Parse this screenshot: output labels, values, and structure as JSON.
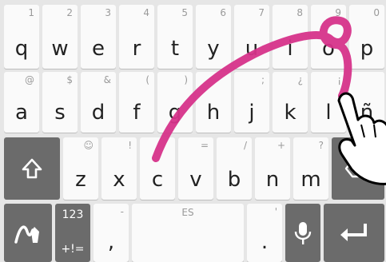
{
  "keyboard": {
    "row1": [
      {
        "letter": "q",
        "hint": "1"
      },
      {
        "letter": "w",
        "hint": "2"
      },
      {
        "letter": "e",
        "hint": "3"
      },
      {
        "letter": "r",
        "hint": "4"
      },
      {
        "letter": "t",
        "hint": "5"
      },
      {
        "letter": "y",
        "hint": "6"
      },
      {
        "letter": "u",
        "hint": "7"
      },
      {
        "letter": "i",
        "hint": "8"
      },
      {
        "letter": "o",
        "hint": "9"
      },
      {
        "letter": "p",
        "hint": "0"
      }
    ],
    "row2": [
      {
        "letter": "a",
        "hint": "@"
      },
      {
        "letter": "s",
        "hint": "$"
      },
      {
        "letter": "d",
        "hint": "&"
      },
      {
        "letter": "f",
        "hint": "("
      },
      {
        "letter": "g",
        "hint": ")"
      },
      {
        "letter": "h",
        "hint": ""
      },
      {
        "letter": "j",
        "hint": ";"
      },
      {
        "letter": "k",
        "hint": "¿"
      },
      {
        "letter": "l",
        "hint": "¡"
      },
      {
        "letter": "ñ",
        "hint": ""
      }
    ],
    "row3": [
      {
        "letter": "z",
        "hint": "☺"
      },
      {
        "letter": "x",
        "hint": "!"
      },
      {
        "letter": "c",
        "hint": ""
      },
      {
        "letter": "v",
        "hint": "="
      },
      {
        "letter": "b",
        "hint": "/"
      },
      {
        "letter": "n",
        "hint": "+"
      },
      {
        "letter": "m",
        "hint": "?"
      }
    ],
    "row4": {
      "numbers_label": "123",
      "symbols_label": "+!=",
      "comma": ",",
      "comma_hint": "-",
      "space_language": "ES",
      "period": ".",
      "period_hint": "'"
    }
  },
  "icons": {
    "shift": "shift-icon",
    "swipe": "swipe-mode-icon",
    "mic": "microphone-icon",
    "enter": "enter-icon",
    "backspace": "backspace-icon",
    "hand": "hand-pointer-icon"
  },
  "colors": {
    "trail": "#d6338a",
    "key": "#fafafa",
    "dark_key": "#6b6b6b"
  }
}
